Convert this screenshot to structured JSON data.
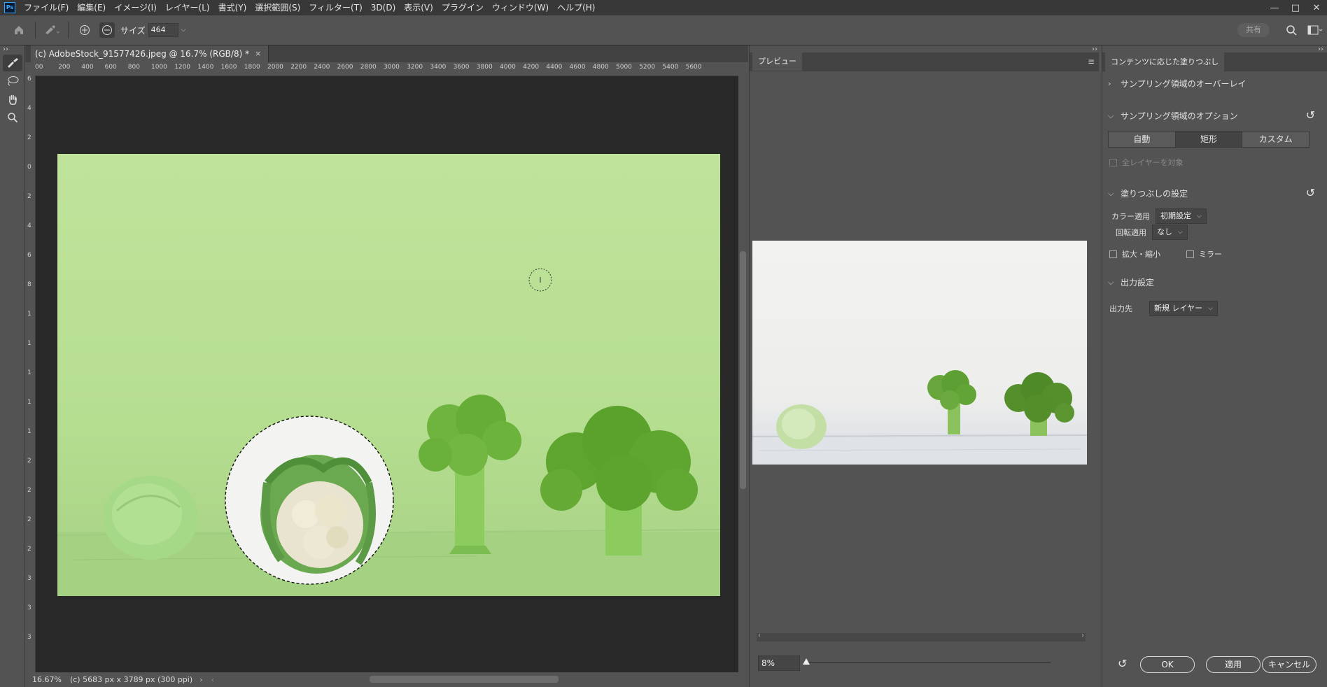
{
  "app": {
    "logo": "Ps"
  },
  "menu": [
    "ファイル(F)",
    "編集(E)",
    "イメージ(I)",
    "レイヤー(L)",
    "書式(Y)",
    "選択範囲(S)",
    "フィルター(T)",
    "3D(D)",
    "表示(V)",
    "プラグイン",
    "ウィンドウ(W)",
    "ヘルプ(H)"
  ],
  "window_controls": {
    "minimize": "—",
    "maximize": "□",
    "close": "✕"
  },
  "options": {
    "size_label": "サイズ",
    "size_value": "464",
    "share_label": "共有"
  },
  "document": {
    "tab_title": "(c) AdobeStock_91577426.jpeg @ 16.7% (RGB/8) *",
    "close_glyph": "×",
    "ruler_h": [
      "00",
      "200",
      "400",
      "600",
      "800",
      "1000",
      "1200",
      "1400",
      "1600",
      "1800",
      "2000",
      "2200",
      "2400",
      "2600",
      "2800",
      "3000",
      "3200",
      "3400",
      "3600",
      "3800",
      "4000",
      "4200",
      "4400",
      "4600",
      "4800",
      "5000",
      "5200",
      "5400",
      "5600"
    ],
    "ruler_v": [
      "6",
      "4",
      "2",
      "0",
      "2",
      "4",
      "6",
      "8",
      "1",
      "1",
      "1",
      "1",
      "1",
      "2",
      "2",
      "2",
      "2",
      "3",
      "3",
      "3"
    ],
    "status_zoom": "16.67%",
    "status_info": "(c) 5683 px x 3789 px (300 ppi)"
  },
  "preview": {
    "tab_label": "プレビュー",
    "zoom_value": "8%",
    "zoom_fraction": 0.0
  },
  "content_aware": {
    "tab_label": "コンテンツに応じた塗りつぶし",
    "sampling_overlay": "サンプリング領域のオーバーレイ",
    "sampling_options": "サンプリング領域のオプション",
    "sampling_modes": [
      "自動",
      "矩形",
      "カスタム"
    ],
    "selected_mode": "矩形",
    "all_layers": "全レイヤーを対象",
    "fill_settings": "塗りつぶしの設定",
    "color_adapt_label": "カラー適用",
    "color_adapt_value": "初期設定",
    "rotation_label": "回転適用",
    "rotation_value": "なし",
    "scale_label": "拡大・縮小",
    "mirror_label": "ミラー",
    "output_settings": "出力設定",
    "output_label": "出力先",
    "output_value": "新規 レイヤー",
    "ok_label": "OK",
    "apply_label": "適用",
    "cancel_label": "キャンセル"
  },
  "colors": {
    "accent": "#31a8ff",
    "panel": "#535353",
    "canvas_bg": "#282828",
    "image_bg": "#bfe39b"
  }
}
